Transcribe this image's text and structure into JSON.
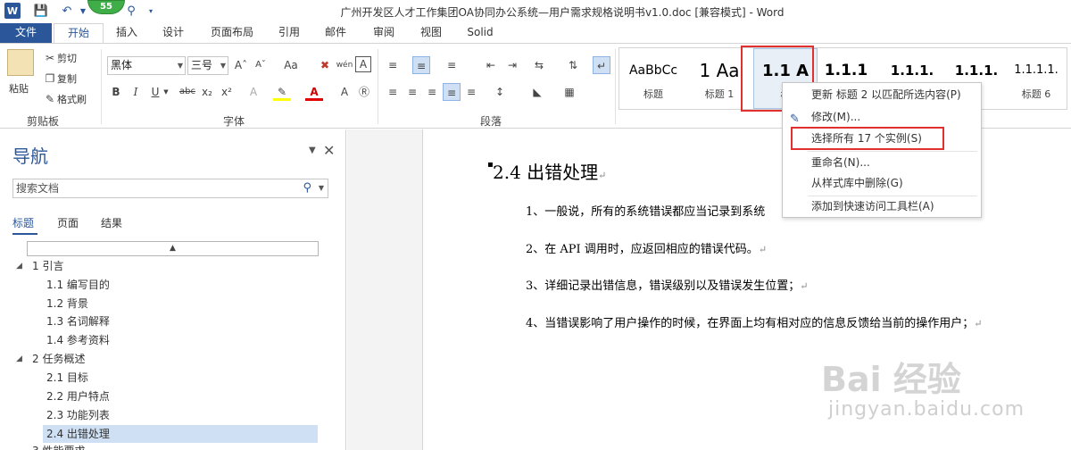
{
  "window": {
    "title": "广州开发区人才工作集团OA协同办公系统—用户需求规格说明书v1.0.doc [兼容模式] - Word",
    "badge": "55",
    "icons": [
      "word-icon",
      "save-icon",
      "undo-icon",
      "customize-icon"
    ]
  },
  "tabs": [
    "文件",
    "开始",
    "插入",
    "设计",
    "页面布局",
    "引用",
    "邮件",
    "审阅",
    "视图",
    "Solid"
  ],
  "ribbon": {
    "clipboard": {
      "paste": "粘贴",
      "cut": "剪切",
      "copy": "复制",
      "format_painter": "格式刷",
      "label": "剪贴板"
    },
    "font": {
      "name": "黑体",
      "size": "三号",
      "label": "字体",
      "aa": "Aa",
      "wen": "wén",
      "bold": "B",
      "italic": "I",
      "underline": "U",
      "strike": "abc",
      "sub": "x₂",
      "sup": "x²"
    },
    "paragraph": {
      "label": "段落"
    },
    "styles": [
      {
        "preview": "AaBbCc",
        "name": "标题"
      },
      {
        "preview": "1  Aa",
        "name": "标题 1"
      },
      {
        "preview": "1.1  A",
        "name": "标"
      },
      {
        "preview": "1.1.1",
        "name": ""
      },
      {
        "preview": "1.1.1.",
        "name": ""
      },
      {
        "preview": "1.1.1.",
        "name": "5"
      },
      {
        "preview": "1.1.1.1.",
        "name": "标题 6"
      }
    ]
  },
  "context_menu": {
    "items": [
      "更新 标题 2 以匹配所选内容(P)",
      "修改(M)...",
      "选择所有 17 个实例(S)",
      "重命名(N)...",
      "从样式库中删除(G)",
      "添加到快速访问工具栏(A)"
    ]
  },
  "nav": {
    "title": "导航",
    "search_placeholder": "搜索文档",
    "tabs": [
      "标题",
      "页面",
      "结果"
    ],
    "tree": [
      {
        "label": "1 引言",
        "level": 1
      },
      {
        "label": "1.1 编写目的",
        "level": 2
      },
      {
        "label": "1.2 背景",
        "level": 2
      },
      {
        "label": "1.3 名词解释",
        "level": 2
      },
      {
        "label": "1.4 参考资料",
        "level": 2
      },
      {
        "label": "2 任务概述",
        "level": 1
      },
      {
        "label": "2.1 目标",
        "level": 2
      },
      {
        "label": "2.2 用户特点",
        "level": 2
      },
      {
        "label": "2.3 功能列表",
        "level": 2
      },
      {
        "label": "2.4 出错处理",
        "level": 2,
        "selected": true
      },
      {
        "label": "3 性能要求",
        "level": 1
      }
    ]
  },
  "document": {
    "heading": "2.4 出错处理",
    "paragraphs": [
      "1、一般说，所有的系统错误都应当记录到系统",
      "2、在 API 调用时，应返回相应的错误代码。",
      "3、详细记录出错信息，错误级别以及错误发生位置；",
      "4、当错误影响了用户操作的时候，在界面上均有相对应的信息反馈给当前的操作用户；"
    ]
  },
  "watermark": {
    "brand": "Bai 经验",
    "url": "jingyan.baidu.com"
  }
}
